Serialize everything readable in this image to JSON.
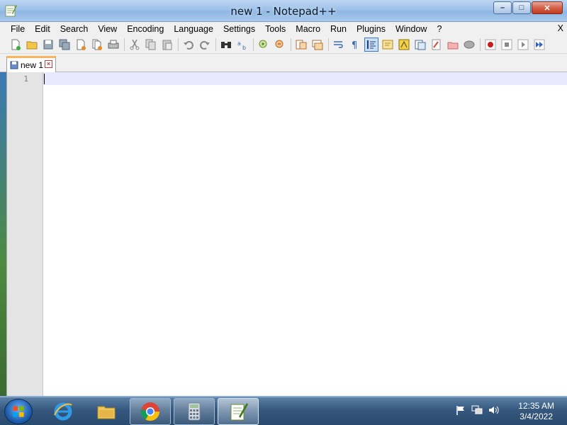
{
  "window": {
    "title": "new 1 - Notepad++",
    "minimize_label": "–",
    "maximize_label": "□",
    "close_label": "✕"
  },
  "menu": {
    "items": [
      "File",
      "Edit",
      "Search",
      "View",
      "Encoding",
      "Language",
      "Settings",
      "Tools",
      "Macro",
      "Run",
      "Plugins",
      "Window",
      "?"
    ],
    "close_label": "X"
  },
  "toolbar": {
    "groups": [
      [
        "new-file-icon",
        "open-file-icon",
        "save-icon",
        "save-all-icon",
        "close-icon",
        "close-all-icon",
        "print-icon"
      ],
      [
        "cut-icon",
        "copy-icon",
        "paste-icon"
      ],
      [
        "undo-icon",
        "redo-icon"
      ],
      [
        "find-icon",
        "replace-icon"
      ],
      [
        "zoom-in-icon",
        "zoom-out-icon"
      ],
      [
        "sync-vertical-icon",
        "sync-horizontal-icon"
      ],
      [
        "word-wrap-icon",
        "show-all-chars-icon",
        "indent-guide-icon",
        "user-language-icon",
        "document-map-icon",
        "function-list-icon",
        "folder-workspace-icon",
        "monitoring-icon",
        "record-macro-icon",
        "stop-macro-icon",
        "play-macro-icon",
        "run-macro-multiple-icon"
      ]
    ],
    "active": "indent-guide-icon"
  },
  "tabs": [
    {
      "label": "new 1",
      "close_label": "⊠"
    }
  ],
  "editor": {
    "line_numbers": [
      "1"
    ],
    "content": ""
  },
  "taskbar": {
    "apps": [
      "internet-explorer-icon",
      "file-explorer-icon",
      "chrome-icon",
      "calculator-icon",
      "notepadpp-icon"
    ],
    "time": "12:35 AM",
    "date": "3/4/2022"
  },
  "colors": {
    "tab_accent": "#fab45e",
    "current_line": "#e8e8ff",
    "title_bar": "#9dc0e8"
  }
}
